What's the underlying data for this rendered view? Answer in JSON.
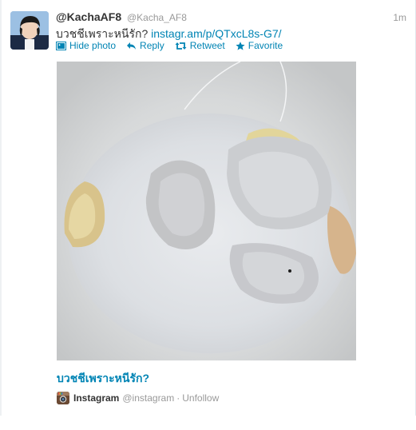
{
  "tweet": {
    "display_name": "@KachaAF8",
    "handle": "@Kacha_AF8",
    "timestamp": "1m",
    "text": "บวชชีเพราะหนีรัก?",
    "link": "instagr.am/p/QTxcL8s-G7/"
  },
  "actions": {
    "hide_photo": "Hide photo",
    "reply": "Reply",
    "retweet": "Retweet",
    "favorite": "Favorite"
  },
  "media": {
    "caption": "บวชชีเพราะหนีรัก?",
    "source_name": "Instagram",
    "source_handle": "@instagram",
    "separator": "·",
    "unfollow": "Unfollow"
  },
  "colors": {
    "link": "#0084b4",
    "text": "#333333",
    "muted": "#999999"
  }
}
